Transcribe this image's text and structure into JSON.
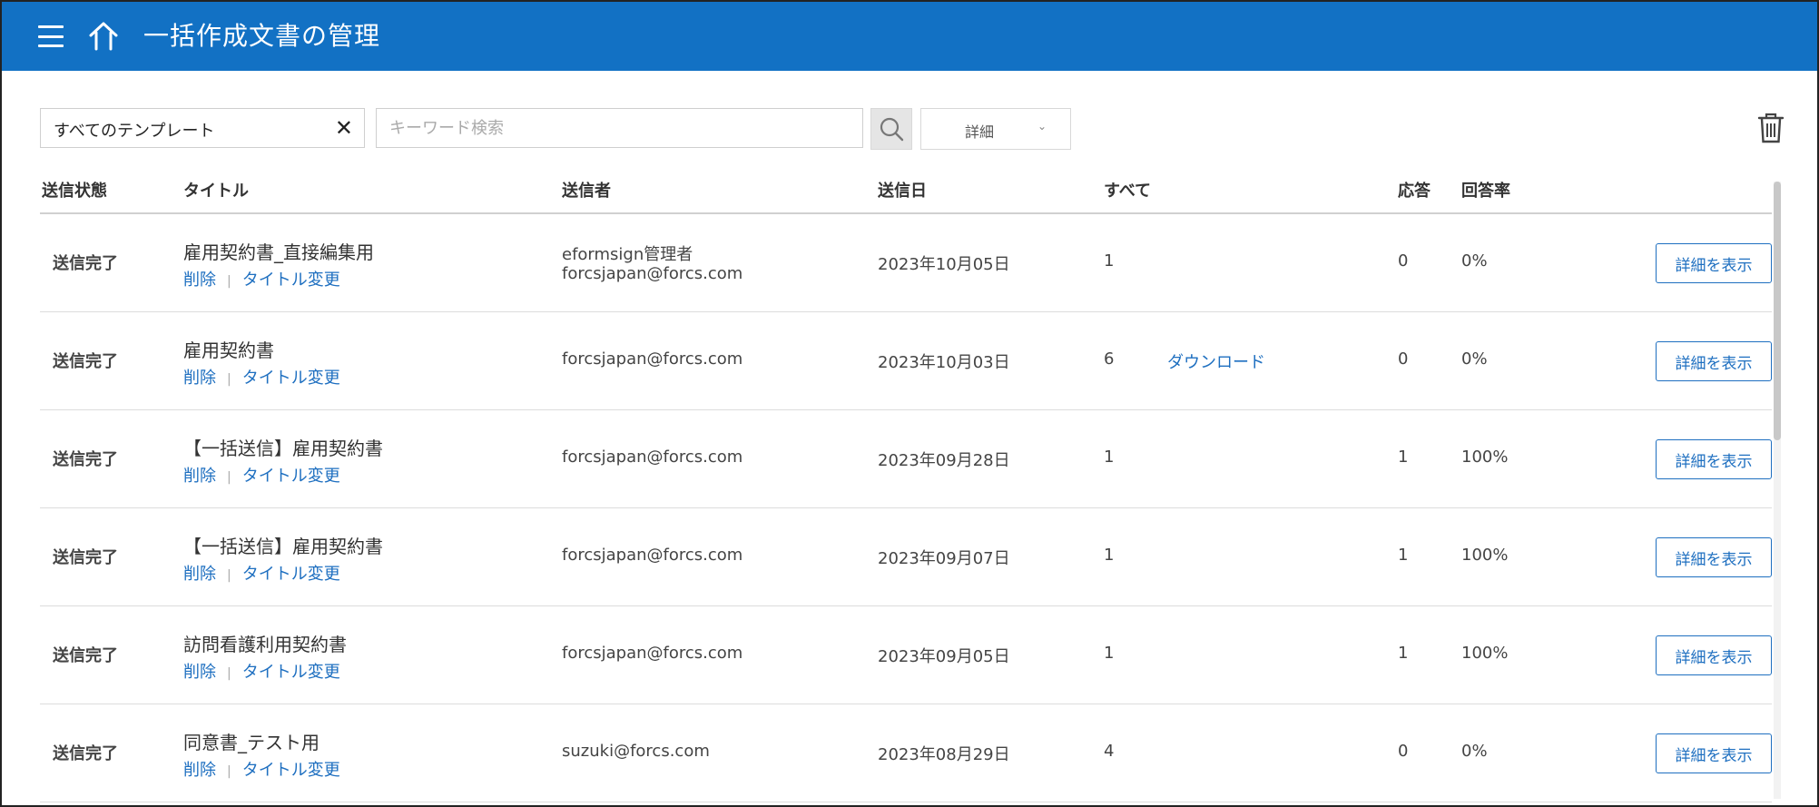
{
  "header": {
    "title": "一括作成文書の管理",
    "menu_icon": "hamburger-menu-icon",
    "home_icon": "home-icon",
    "color": "#1271c4"
  },
  "filters": {
    "template_value": "すべてのテンプレート",
    "clear_icon": "close-x-icon",
    "keyword_placeholder": "キーワード検索",
    "keyword_value": "",
    "search_icon": "magnifier-icon",
    "detail_label": "詳細",
    "detail_chevron": "⌄",
    "trash_icon": "trash-icon"
  },
  "columns": {
    "status": "送信状態",
    "title": "タイトル",
    "sender": "送信者",
    "date": "送信日",
    "all": "すべて",
    "response": "応答",
    "rate": "回答率"
  },
  "row_actions": {
    "delete": "削除",
    "rename": "タイトル変更",
    "separator": "|",
    "view_details": "詳細を表示"
  },
  "rows": [
    {
      "status": "送信完了",
      "title": "雇用契約書_直接編集用",
      "sender_name": "eformsign管理者",
      "sender_email": "forcsjapan@forcs.com",
      "date": "2023年10月05日",
      "all": "1",
      "download": "",
      "response": "0",
      "rate": "0%"
    },
    {
      "status": "送信完了",
      "title": "雇用契約書",
      "sender_name": "",
      "sender_email": "forcsjapan@forcs.com",
      "date": "2023年10月03日",
      "all": "6",
      "download": "ダウンロード",
      "response": "0",
      "rate": "0%"
    },
    {
      "status": "送信完了",
      "title": "【一括送信】雇用契約書",
      "sender_name": "",
      "sender_email": "forcsjapan@forcs.com",
      "date": "2023年09月28日",
      "all": "1",
      "download": "",
      "response": "1",
      "rate": "100%"
    },
    {
      "status": "送信完了",
      "title": "【一括送信】雇用契約書",
      "sender_name": "",
      "sender_email": "forcsjapan@forcs.com",
      "date": "2023年09月07日",
      "all": "1",
      "download": "",
      "response": "1",
      "rate": "100%"
    },
    {
      "status": "送信完了",
      "title": "訪問看護利用契約書",
      "sender_name": "",
      "sender_email": "forcsjapan@forcs.com",
      "date": "2023年09月05日",
      "all": "1",
      "download": "",
      "response": "1",
      "rate": "100%"
    },
    {
      "status": "送信完了",
      "title": "同意書_テスト用",
      "sender_name": "",
      "sender_email": "suzuki@forcs.com",
      "date": "2023年08月29日",
      "all": "4",
      "download": "",
      "response": "0",
      "rate": "0%"
    }
  ],
  "colors": {
    "link": "#1e6fc0",
    "header_bg": "#1271c4"
  }
}
